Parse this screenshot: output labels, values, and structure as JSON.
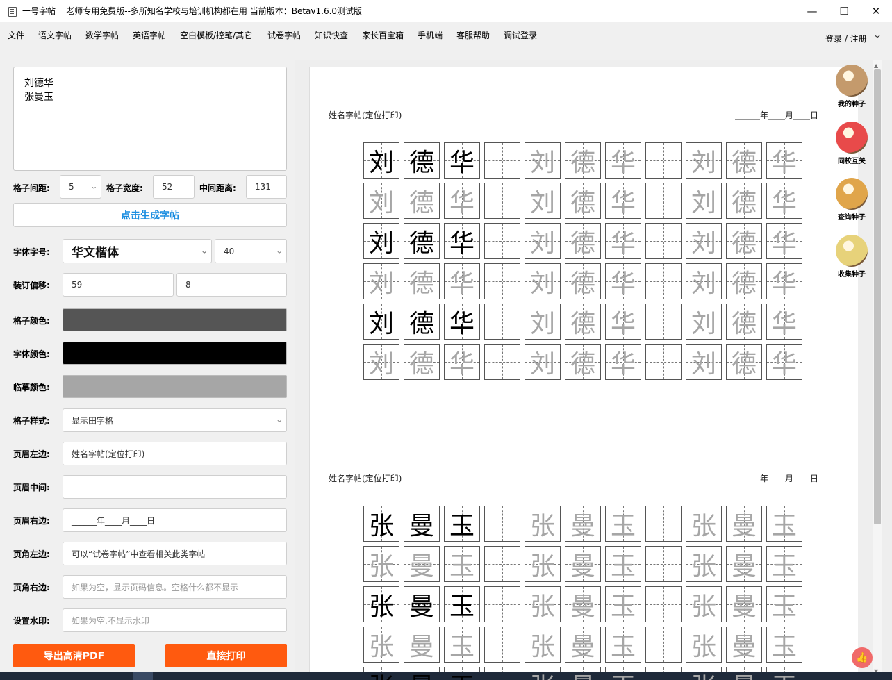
{
  "window": {
    "title": "一号字帖    老师专用免费版--多所知名学校与培训机构都在用 当前版本：Betav1.6.0测试版",
    "minimize": "—",
    "maximize": "☐",
    "close": "✕"
  },
  "menu": {
    "items": [
      "文件",
      "语文字帖",
      "数学字帖",
      "英语字帖",
      "空白模板/控笔/其它",
      "试卷字帖",
      "知识快查",
      "家长百宝箱",
      "手机端",
      "客服帮助",
      "调试登录"
    ],
    "login": "登录 / 注册",
    "login_chevron": "⌄"
  },
  "left": {
    "names_lines": [
      "刘德华",
      "张曼玉"
    ],
    "grid_gap_label": "格子间距:",
    "grid_gap_value": "5",
    "grid_width_label": "格子宽度:",
    "grid_width_value": "52",
    "middle_distance_label": "中间距离:",
    "middle_distance_value": "131",
    "generate_button": "点击生成字帖",
    "font_label": "字体字号:",
    "font_name": "华文楷体",
    "font_size": "40",
    "binding_label": "装订偏移:",
    "binding_x": "59",
    "binding_y": "8",
    "grid_color_label": "格子颜色:",
    "grid_color": "#555555",
    "font_color_label": "字体颜色:",
    "font_color": "#000000",
    "trace_color_label": "临摹颜色:",
    "trace_color": "#a6a6a6",
    "grid_style_label": "格子样式:",
    "grid_style_value": "显示田字格",
    "header_left_label": "页眉左边:",
    "header_left_value": "姓名字帖(定位打印)",
    "header_middle_label": "页眉中间:",
    "header_middle_value": "",
    "header_right_label": "页眉右边:",
    "header_right_value": "______年____月____日",
    "footer_left_label": "页角左边:",
    "footer_left_value": "可以“试卷字帖”中查看相关此类字帖",
    "footer_right_label": "页角右边:",
    "footer_right_placeholder": "如果为空，显示页码信息。空格什么都不显示",
    "watermark_label": "设置水印:",
    "watermark_placeholder": "如果为空,不显示水印",
    "export_button": "导出高清PDF",
    "print_button": "直接打印"
  },
  "preview": {
    "sections": [
      {
        "header_left": "姓名字帖(定位打印)",
        "header_right": "______年____月____日",
        "chars": [
          "刘",
          "德",
          "华"
        ]
      },
      {
        "header_left": "姓名字帖(定位打印)",
        "header_right": "______年____月____日",
        "chars": [
          "张",
          "曼",
          "玉"
        ]
      }
    ]
  },
  "side": {
    "items": [
      {
        "label": "我的种子",
        "icon": "sunflower-seed-icon",
        "color": "#c49a6c"
      },
      {
        "label": "同校互关",
        "icon": "strawberry-icon",
        "color": "#e84a4a"
      },
      {
        "label": "查询种子",
        "icon": "snail-shell-icon",
        "color": "#e0a54a"
      },
      {
        "label": "收集种子",
        "icon": "collect-seed-icon",
        "color": "#e7d27a"
      }
    ]
  },
  "like_icon": "👍"
}
